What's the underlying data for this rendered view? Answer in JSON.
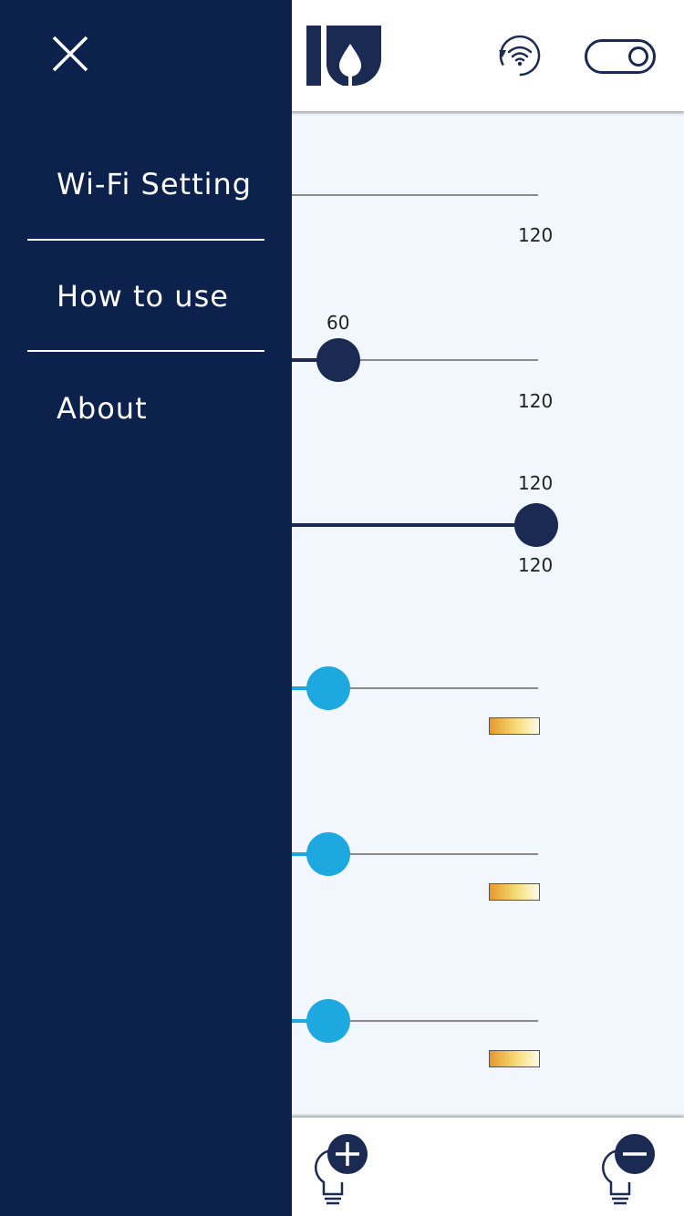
{
  "drawer": {
    "menu": [
      {
        "label": "Wi-Fi Setting"
      },
      {
        "label": "How to use"
      },
      {
        "label": "About"
      }
    ]
  },
  "header": {
    "icons": [
      "logo-icon",
      "wifi-refresh-icon",
      "power-toggle-icon"
    ],
    "toggle_state": "on"
  },
  "sliders": [
    {
      "value_label": "",
      "max_label": "120"
    },
    {
      "value_label": "60",
      "max_label": "120",
      "value": 60,
      "max": 120
    },
    {
      "value_label": "120",
      "max_label": "120",
      "value": 120,
      "max": 120
    }
  ],
  "color_sliders": [
    {
      "icon": "color-temperature-gradient-icon"
    },
    {
      "icon": "color-temperature-gradient-icon"
    },
    {
      "icon": "color-temperature-gradient-icon"
    }
  ],
  "footer": {
    "icons": [
      "bulb-add-icon",
      "bulb-remove-icon"
    ]
  },
  "colors": {
    "drawer_bg": "#0c224c",
    "dark_thumb": "#1a2a52",
    "light_thumb": "#1ea8e0",
    "content_bg": "#f1f7fd"
  }
}
